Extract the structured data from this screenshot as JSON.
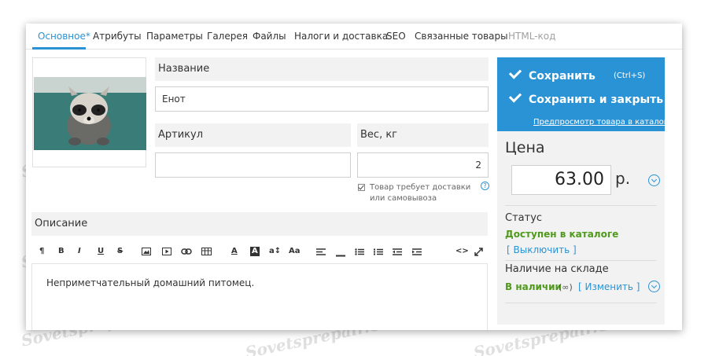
{
  "tabs": [
    {
      "label": "Основное*",
      "state": "active"
    },
    {
      "label": "Атрибуты",
      "state": "normal"
    },
    {
      "label": "Параметры",
      "state": "normal"
    },
    {
      "label": "Галерея",
      "state": "normal"
    },
    {
      "label": "Файлы",
      "state": "normal"
    },
    {
      "label": "Налоги и доставка",
      "state": "normal"
    },
    {
      "label": "SEO",
      "state": "normal"
    },
    {
      "label": "Связанные товары",
      "state": "normal"
    },
    {
      "label": "HTML-код",
      "state": "disabled"
    }
  ],
  "product": {
    "name_label": "Название",
    "name_value": "Енот",
    "sku_label": "Артикул",
    "sku_value": "",
    "weight_label": "Вес, кг",
    "weight_value": "2",
    "shipping_checkbox_label": "Товар требует доставки или самовывоза",
    "shipping_checked": true,
    "help_glyph": "?"
  },
  "description": {
    "label": "Описание",
    "text": "Неприметчательный домашний питомец.",
    "toolbar": [
      "¶",
      "B",
      "I",
      "U",
      "S",
      "img",
      "video",
      "link",
      "table",
      "A",
      "A",
      "a↕",
      "Aa",
      "align",
      "hr",
      "ul",
      "ol",
      "outdent",
      "indent",
      "<>",
      "fullscreen"
    ]
  },
  "save_panel": {
    "save_label": "Сохранить",
    "shortcut": "(Ctrl+S)",
    "save_close_label": "Сохранить и закрыть",
    "preview_label": "Предпросмотр товара в каталоге"
  },
  "price": {
    "label": "Цена",
    "value": "63.00",
    "currency": "р."
  },
  "status": {
    "label": "Статус",
    "value": "Доступен в каталоге",
    "toggle_label": "[ Выключить ]"
  },
  "stock": {
    "label": "Наличие на складе",
    "value": "В наличии",
    "infinity": "(∞)",
    "change_label": "[ Изменить ]"
  },
  "watermark": "Sovetsprepair.Com",
  "colors": {
    "accent": "#2a93d5",
    "status_green": "#4f9a1c",
    "panel_bg": "#f2f2f2"
  }
}
